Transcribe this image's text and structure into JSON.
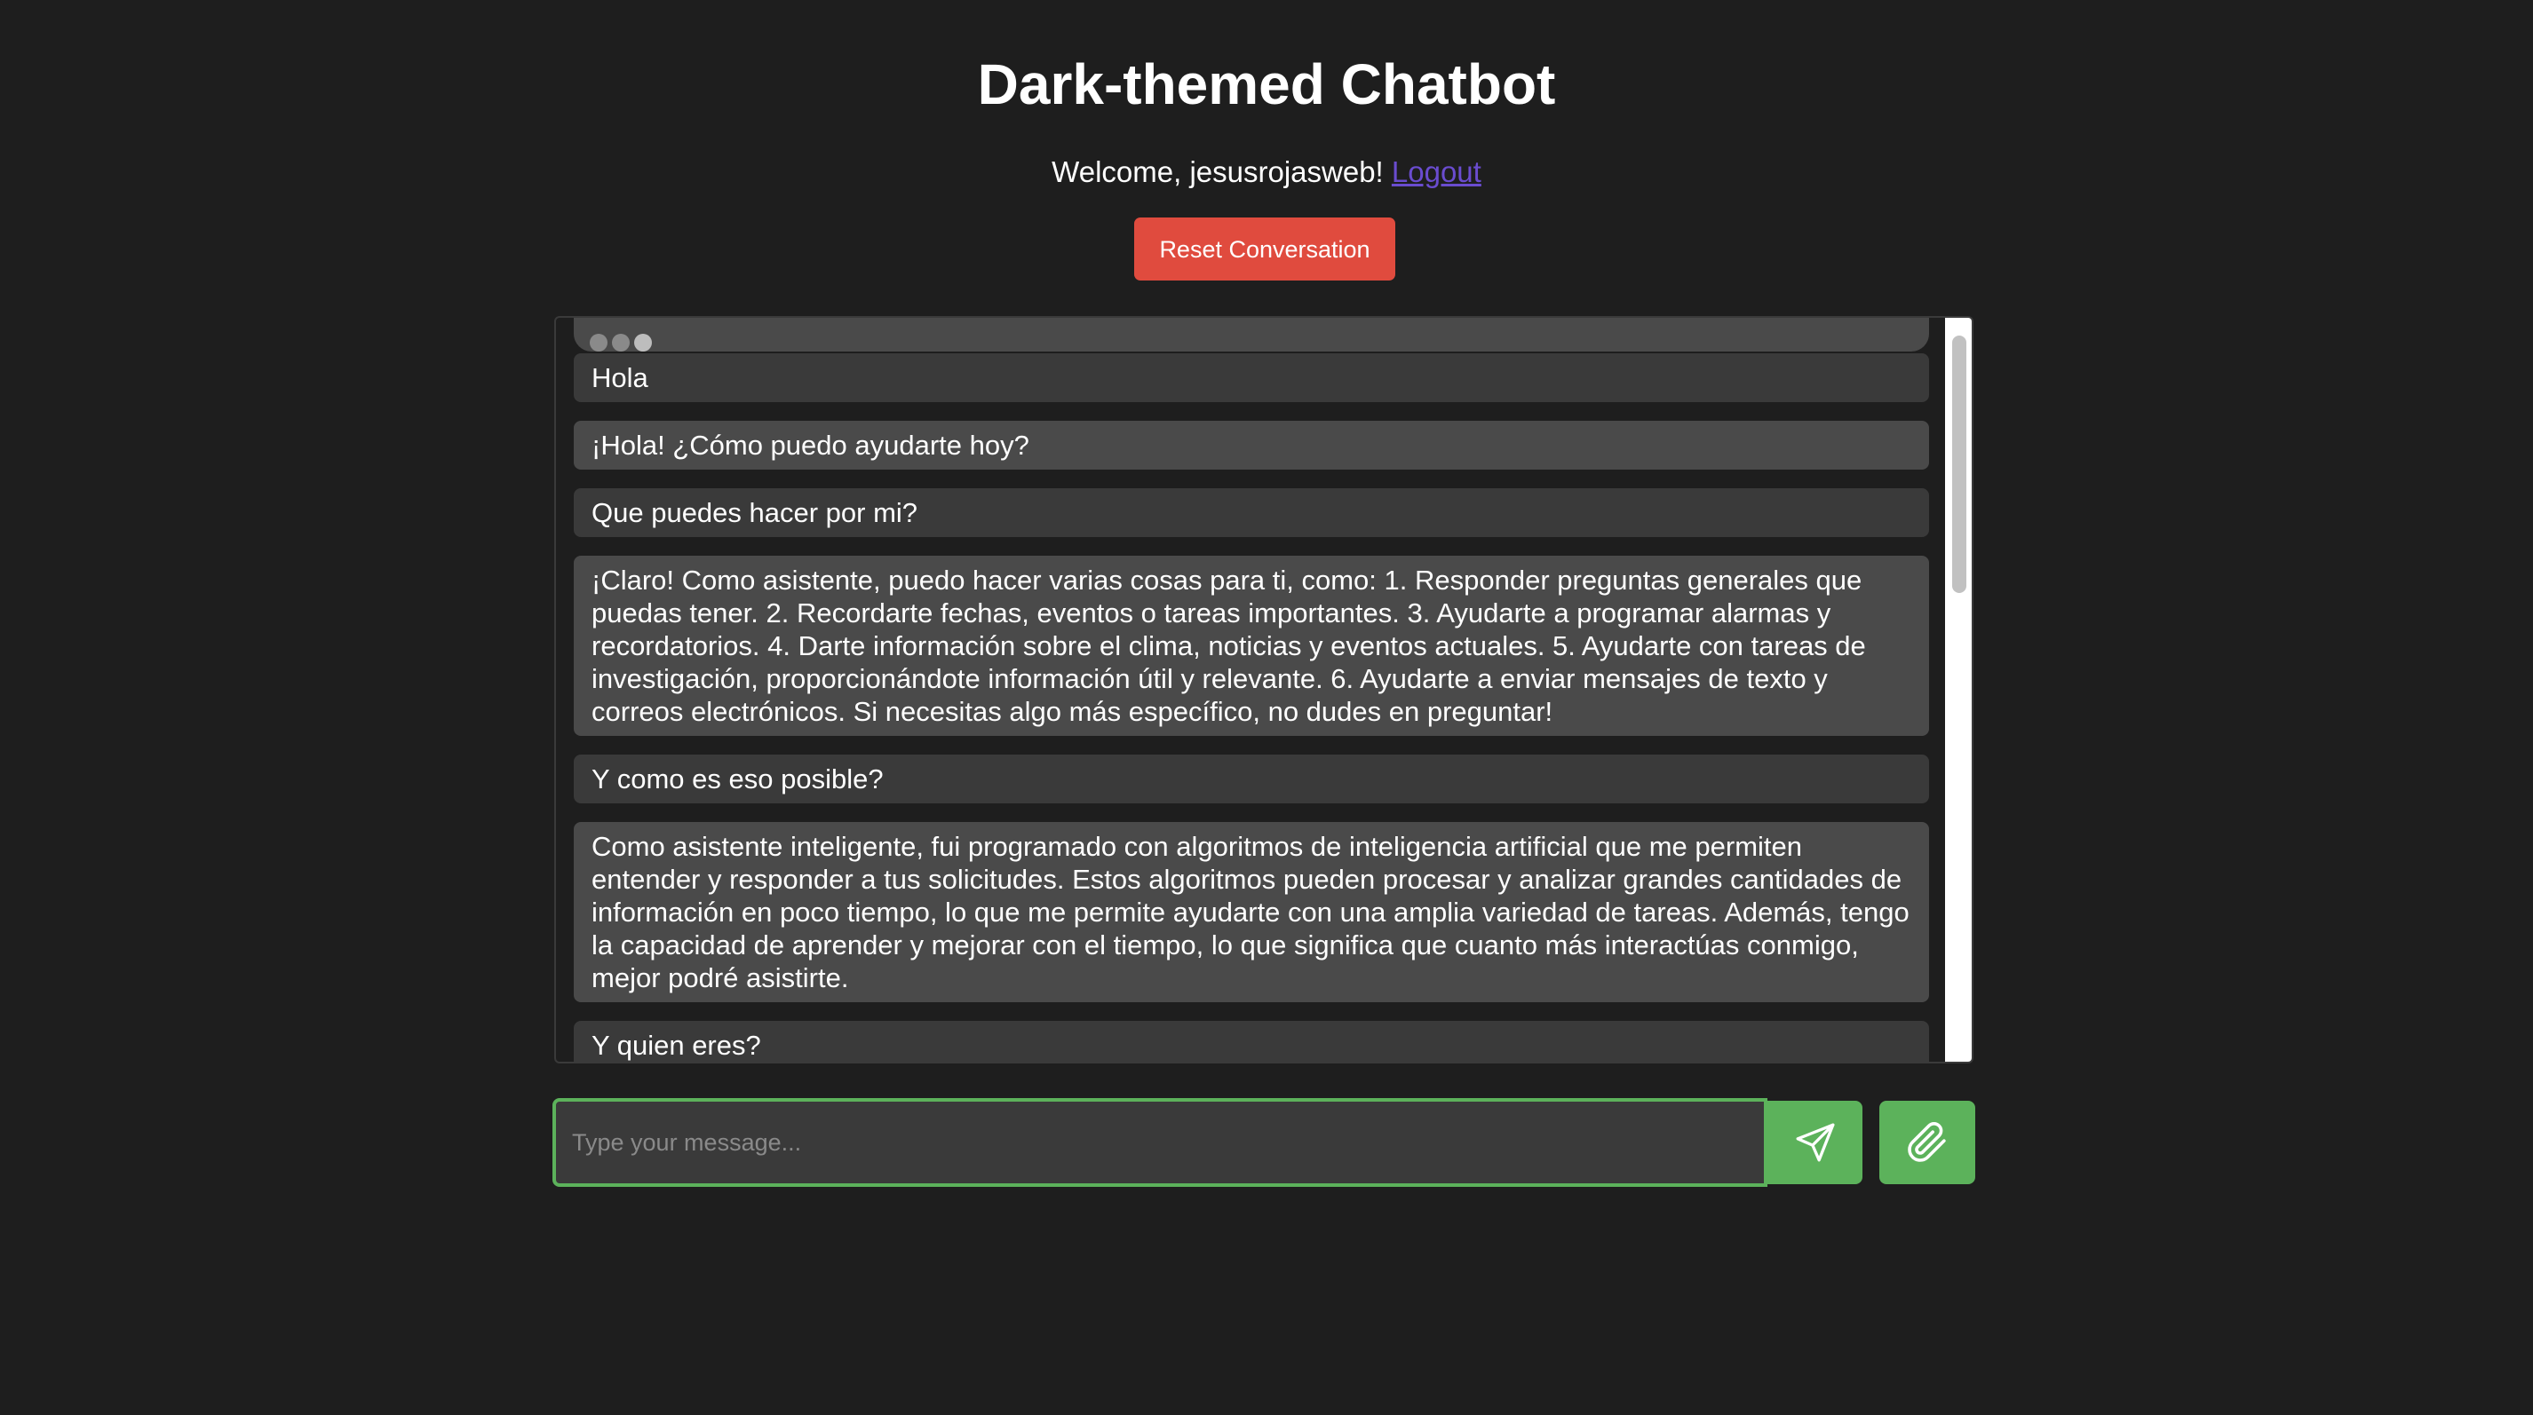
{
  "header": {
    "title": "Dark-themed Chatbot",
    "welcome_text": "Welcome, jesusrojasweb!",
    "logout_label": "Logout"
  },
  "controls": {
    "reset_label": "Reset Conversation"
  },
  "messages": [
    {
      "role": "user",
      "text": "Hola"
    },
    {
      "role": "bot",
      "text": "¡Hola! ¿Cómo puedo ayudarte hoy?"
    },
    {
      "role": "user",
      "text": "Que puedes hacer por mi?"
    },
    {
      "role": "bot",
      "text": "¡Claro! Como asistente, puedo hacer varias cosas para ti, como: 1. Responder preguntas generales que puedas tener. 2. Recordarte fechas, eventos o tareas importantes. 3. Ayudarte a programar alarmas y recordatorios. 4. Darte información sobre el clima, noticias y eventos actuales. 5. Ayudarte con tareas de investigación, proporcionándote información útil y relevante. 6. Ayudarte a enviar mensajes de texto y correos electrónicos. Si necesitas algo más específico, no dudes en preguntar!"
    },
    {
      "role": "user",
      "text": "Y como es eso posible?"
    },
    {
      "role": "bot",
      "text": "Como asistente inteligente, fui programado con algoritmos de inteligencia artificial que me permiten entender y responder a tus solicitudes. Estos algoritmos pueden procesar y analizar grandes cantidades de información en poco tiempo, lo que me permite ayudarte con una amplia variedad de tareas. Además, tengo la capacidad de aprender y mejorar con el tiempo, lo que significa que cuanto más interactúas conmigo, mejor podré asistirte."
    },
    {
      "role": "user",
      "text": "Y quien eres?"
    }
  ],
  "input": {
    "placeholder": "Type your message...",
    "value": ""
  },
  "icons": {
    "send": "send-icon",
    "attach": "paperclip-icon",
    "typing": "typing-indicator-icon"
  },
  "colors": {
    "background": "#1e1e1e",
    "accent": "#5cb25b",
    "reset": "#e04b3e",
    "link": "#6a4ccf"
  }
}
